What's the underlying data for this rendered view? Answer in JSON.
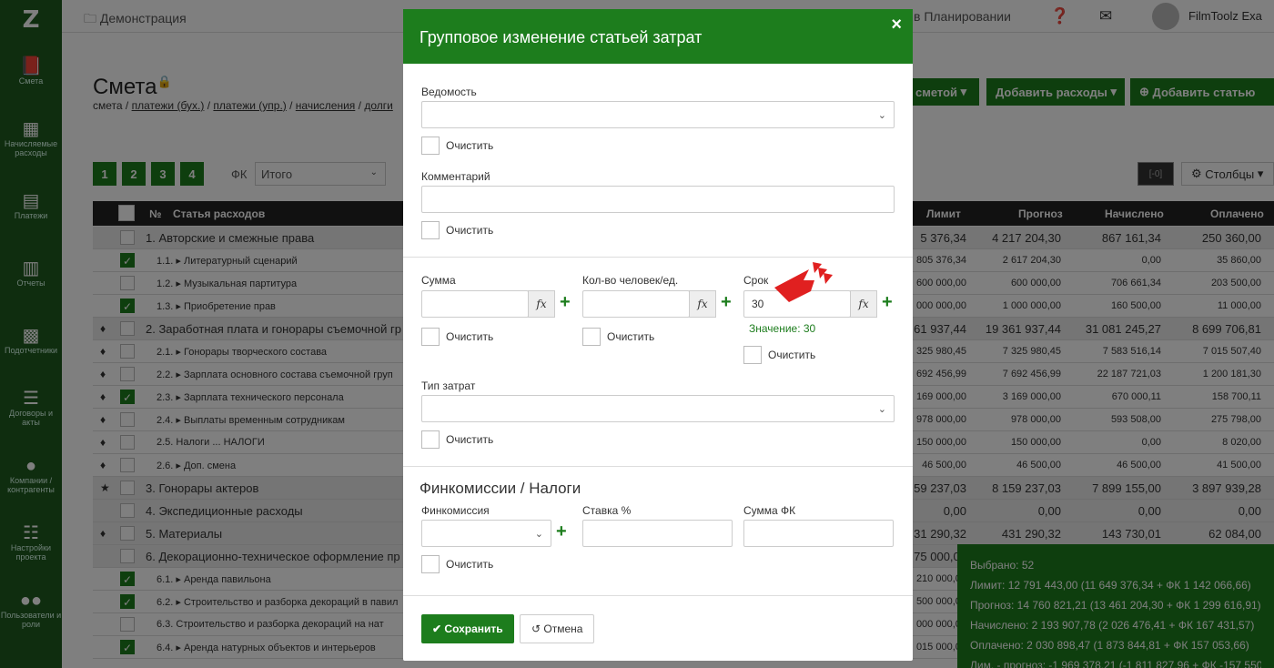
{
  "sidebar": {
    "items": [
      {
        "label": "Смета",
        "icon": "book-icon"
      },
      {
        "label": "Начисляемые расходы",
        "icon": "calendar-icon"
      },
      {
        "label": "Платежи",
        "icon": "card-icon"
      },
      {
        "label": "Отчеты",
        "icon": "chart-icon"
      },
      {
        "label": "Подотчетники",
        "icon": "briefcase-icon"
      },
      {
        "label": "Договоры и акты",
        "icon": "list-icon"
      },
      {
        "label": "Компании / контрагенты",
        "icon": "user-icon"
      },
      {
        "label": "Настройки проекта",
        "icon": "sliders-icon"
      },
      {
        "label": "Пользователи и роли",
        "icon": "users-icon"
      }
    ]
  },
  "topbar": {
    "breadcrumb": "Демонстрация",
    "planning": "в Планировании",
    "user": "FilmToolz Exa"
  },
  "page": {
    "title": "Смета",
    "links": [
      "смета",
      "платежи (бух.)",
      "платежи (упр.)",
      "начисления",
      "долги"
    ],
    "btn_smeta": "сметой",
    "btn_add_expenses": "Добавить расходы",
    "btn_add_article": "Добавить статью",
    "levels": [
      "1",
      "2",
      "3",
      "4"
    ],
    "fk_label": "ФК",
    "fk_value": "Итого",
    "columns_btn": "Столбцы"
  },
  "table": {
    "headers": {
      "no": "№",
      "article": "Статья расходов",
      "limit": "Лимит",
      "forecast": "Прогноз",
      "accrued": "Начислено",
      "paid": "Оплачено"
    },
    "rows": [
      {
        "kind": "sec",
        "mark": "",
        "cb": false,
        "name": "1. Авторские и смежные права",
        "limit": "5 376,34",
        "forecast": "4 217 204,30",
        "accrued": "867 161,34",
        "paid": "250 360,00"
      },
      {
        "kind": "item",
        "mark": "",
        "cb": true,
        "name": "1.1.  ▸ Литературный сценарий",
        "limit": "805 376,34",
        "forecast": "2 617 204,30",
        "accrued": "0,00",
        "paid": "35 860,00"
      },
      {
        "kind": "item",
        "mark": "",
        "cb": false,
        "name": "1.2.  ▸ Музыкальная партитура",
        "limit": "600 000,00",
        "forecast": "600 000,00",
        "accrued": "706 661,34",
        "paid": "203 500,00"
      },
      {
        "kind": "item",
        "mark": "",
        "cb": true,
        "name": "1.3.  ▸ Приобретение прав",
        "limit": "000 000,00",
        "forecast": "1 000 000,00",
        "accrued": "160 500,00",
        "paid": "11 000,00"
      },
      {
        "kind": "sec",
        "mark": "♦",
        "cb": false,
        "name": "2. Заработная плата и гонорары съемочной гр",
        "limit": "61 937,44",
        "forecast": "19 361 937,44",
        "accrued": "31 081 245,27",
        "paid": "8 699 706,81"
      },
      {
        "kind": "item",
        "mark": "♦",
        "cb": false,
        "name": "2.1.  ▸ Гонорары творческого состава",
        "limit": "325 980,45",
        "forecast": "7 325 980,45",
        "accrued": "7 583 516,14",
        "paid": "7 015 507,40"
      },
      {
        "kind": "item",
        "mark": "♦",
        "cb": false,
        "name": "2.2.  ▸ Зарплата основного состава съемочной груп",
        "limit": "692 456,99",
        "forecast": "7 692 456,99",
        "accrued": "22 187 721,03",
        "paid": "1 200 181,30"
      },
      {
        "kind": "item",
        "mark": "♦",
        "cb": true,
        "name": "2.3.  ▸ Зарплата технического персонала",
        "limit": "169 000,00",
        "forecast": "3 169 000,00",
        "accrued": "670 000,11",
        "paid": "158 700,11"
      },
      {
        "kind": "item",
        "mark": "♦",
        "cb": false,
        "name": "2.4.  ▸ Выплаты временным сотрудникам",
        "limit": "978 000,00",
        "forecast": "978 000,00",
        "accrued": "593 508,00",
        "paid": "275 798,00"
      },
      {
        "kind": "item",
        "mark": "♦",
        "cb": false,
        "name": "2.5.      Налоги ... НАЛОГИ",
        "limit": "150 000,00",
        "forecast": "150 000,00",
        "accrued": "0,00",
        "paid": "8 020,00"
      },
      {
        "kind": "item",
        "mark": "♦",
        "cb": false,
        "name": "2.6.  ▸ Доп. смена",
        "limit": "46 500,00",
        "forecast": "46 500,00",
        "accrued": "46 500,00",
        "paid": "41 500,00"
      },
      {
        "kind": "sec",
        "mark": "★",
        "cb": false,
        "name": "3. Гонорары актеров",
        "limit": "59 237,03",
        "forecast": "8 159 237,03",
        "accrued": "7 899 155,00",
        "paid": "3 897 939,28"
      },
      {
        "kind": "sec",
        "mark": "",
        "cb": false,
        "name": "4. Экспедиционные расходы",
        "limit": "0,00",
        "forecast": "0,00",
        "accrued": "0,00",
        "paid": "0,00"
      },
      {
        "kind": "sec",
        "mark": "♦",
        "cb": false,
        "name": "5. Материалы",
        "limit": "31 290,32",
        "forecast": "431 290,32",
        "accrued": "143 730,01",
        "paid": "62 084,00"
      },
      {
        "kind": "sec",
        "mark": "",
        "cb": false,
        "name": "6. Декорационно-техническое оформление пр",
        "limit": "75 000,00",
        "forecast": "",
        "accrued": "",
        "paid": ""
      },
      {
        "kind": "item",
        "mark": "",
        "cb": true,
        "name": "6.1.  ▸ Аренда павильона",
        "limit": "210 000,00",
        "forecast": "",
        "accrued": "",
        "paid": ""
      },
      {
        "kind": "item",
        "mark": "",
        "cb": true,
        "name": "6.2.  ▸ Строительство и разборка декораций в павил",
        "limit": "500 000,00",
        "forecast": "",
        "accrued": "",
        "paid": ""
      },
      {
        "kind": "item",
        "mark": "",
        "cb": false,
        "name": "6.3.      Строительство и разборка декораций на нат",
        "limit": "000 000,00",
        "forecast": "",
        "accrued": "",
        "paid": ""
      },
      {
        "kind": "item",
        "mark": "",
        "cb": true,
        "name": "6.4.  ▸ Аренда натурных объектов и интерьеров",
        "limit": "015 000,00",
        "forecast": "",
        "accrued": "",
        "paid": ""
      }
    ]
  },
  "summary": {
    "lines": [
      "Выбрано: 52",
      "Лимит: 12 791 443,00 (11 649 376,34 + ФК 1 142 066,66)",
      "Прогноз: 14 760 821,21 (13 461 204,30 + ФК 1 299 616,91)",
      "Начислено: 2 193 907,78 (2 026 476,41 + ФК 167 431,57)",
      "Оплачено: 2 030 898,47 (1 873 844,81 + ФК 157 053,66)",
      "Лим. - прогноз: -1 969 378,21 (-1 811 827,96 + ФК -157 550,25"
    ]
  },
  "modal": {
    "title": "Групповое изменение статьей затрат",
    "close": "×",
    "vedomost_label": "Ведомость",
    "clear": "Очистить",
    "comment_label": "Комментарий",
    "sum_label": "Сумма",
    "count_label": "Кол-во человек/ед.",
    "term_label": "Срок",
    "term_value": "30",
    "term_note": "Значение: 30",
    "fx": "fx",
    "type_label": "Тип затрат",
    "fin_title": "Финкомиссии / Налоги",
    "fin_label": "Финкомиссия",
    "rate_label": "Ставка %",
    "fk_sum_label": "Сумма ФК",
    "save": "Сохранить",
    "cancel": "Отмена"
  },
  "colors": {
    "accent": "#1d7d1d",
    "arrow": "#e02020"
  }
}
